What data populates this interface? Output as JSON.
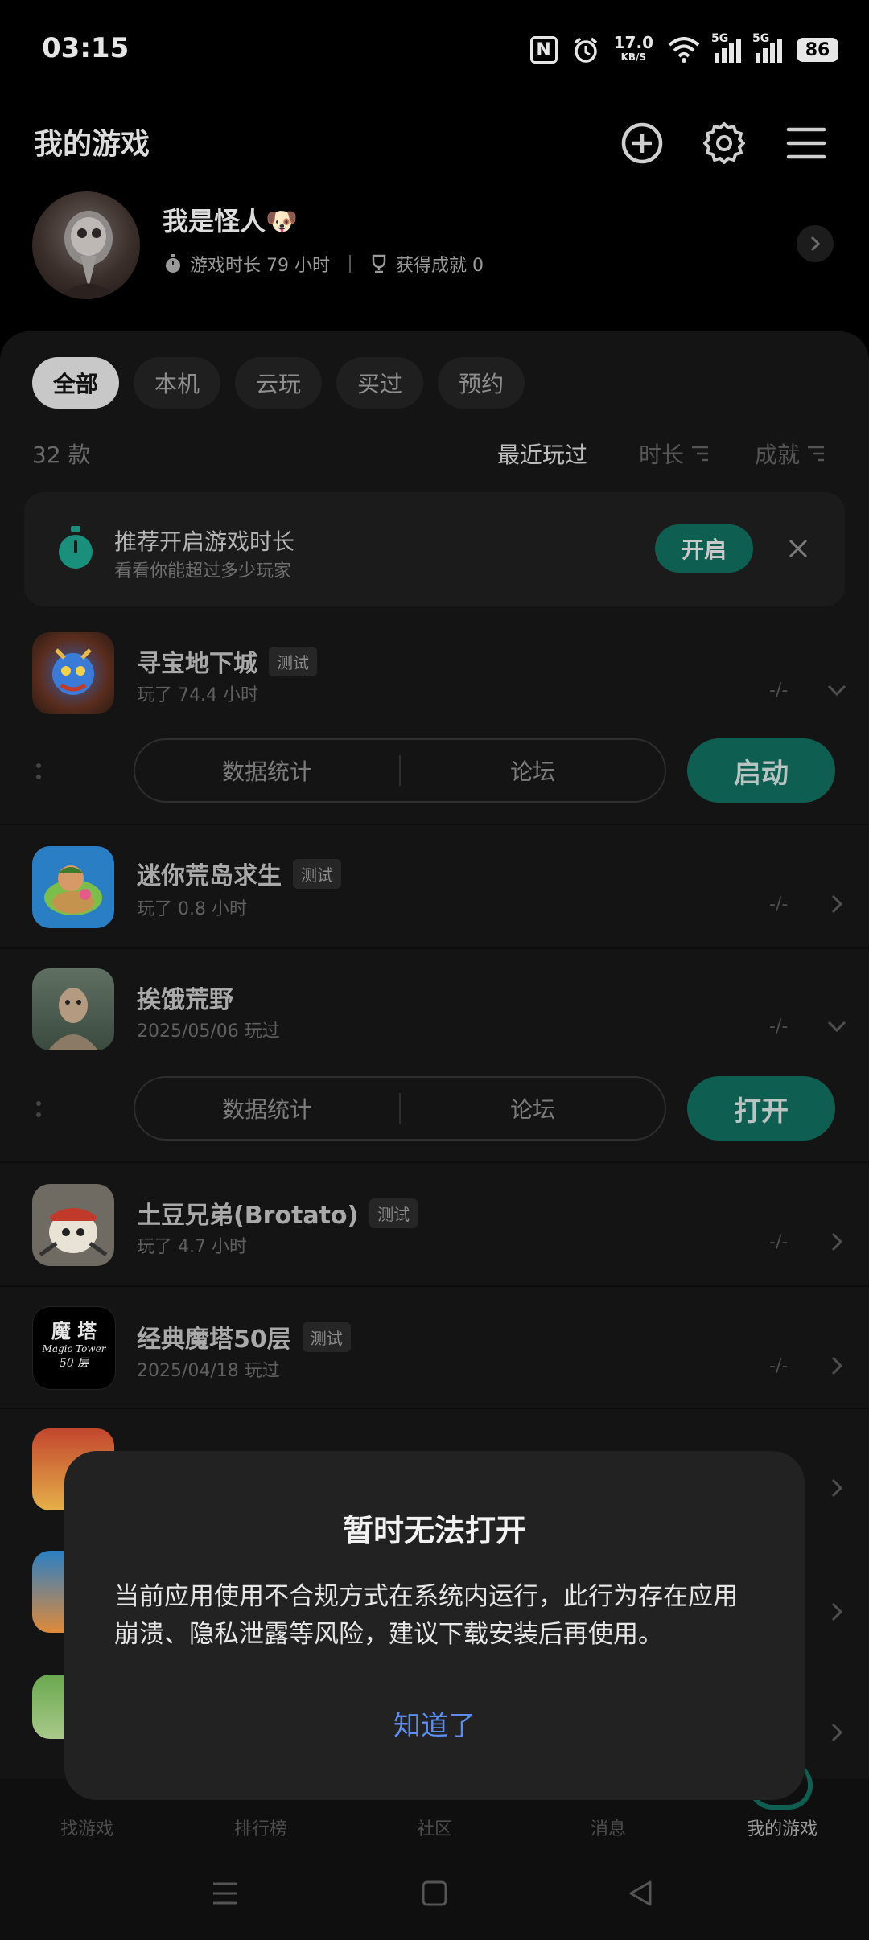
{
  "status_bar": {
    "time": "03:15",
    "speed_value": "17.0",
    "speed_unit": "KB/S",
    "signal1_tag": "5G",
    "signal2_tag": "5G",
    "battery": "86"
  },
  "header": {
    "title": "我的游戏",
    "icons": [
      "add-circle-icon",
      "gear-icon",
      "menu-icon"
    ]
  },
  "profile": {
    "name": "我是怪人🐶",
    "playtime": "游戏时长 79 小时",
    "achievements": "获得成就 0"
  },
  "filters": {
    "chips": [
      "全部",
      "本机",
      "云玩",
      "买过",
      "预约"
    ],
    "active": "全部"
  },
  "list_meta": {
    "count": "32 款",
    "sort_recent": "最近玩过",
    "sort_duration": "时长",
    "sort_achievement": "成就"
  },
  "banner": {
    "title": "推荐开启游戏时长",
    "subtitle": "看看你能超过多少玩家",
    "button": "开启"
  },
  "games": [
    {
      "name": "寻宝地下城",
      "tag": "测试",
      "sub": "玩了 74.4 小时",
      "dash": "-/-",
      "stats": "数据统计",
      "forum": "论坛",
      "action": "启动"
    },
    {
      "name": "迷你荒岛求生",
      "tag": "测试",
      "sub": "玩了 0.8 小时",
      "dash": "-/-"
    },
    {
      "name": "挨饿荒野",
      "tag": "",
      "sub": "2025/05/06 玩过",
      "dash": "-/-",
      "stats": "数据统计",
      "forum": "论坛",
      "action": "打开"
    },
    {
      "name": "土豆兄弟(Brotato)",
      "tag": "测试",
      "sub": "玩了 4.7 小时",
      "dash": "-/-"
    },
    {
      "name": "经典魔塔50层",
      "tag": "测试",
      "sub": "2025/04/18 玩过",
      "dash": "-/-"
    },
    {
      "name": "",
      "tag": "",
      "sub": "",
      "dash": ""
    }
  ],
  "magic_tower_icon": {
    "line1": "魔 塔",
    "line2": "Magic Tower",
    "line3": "50 层"
  },
  "bottom_nav": [
    "找游戏",
    "排行榜",
    "社区",
    "消息",
    "我的游戏"
  ],
  "dialog": {
    "title": "暂时无法打开",
    "body": "当前应用使用不合规方式在系统内运行，此行为存在应用崩溃、隐私泄露等风险，建议下载安装后再使用。",
    "button": "知道了"
  },
  "colors": {
    "accent_green": "#0f5e52",
    "dialog_link": "#5b8ef0",
    "background": "#000000"
  }
}
